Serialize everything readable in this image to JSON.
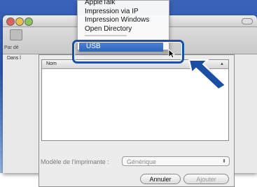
{
  "window": {
    "toolbar_label": "Par dé",
    "sidebar_label": "Dans l"
  },
  "menu": {
    "items": [
      "AppleTalk",
      "Impression via IP",
      "Impression Windows",
      "Open Directory"
    ],
    "selected": "USB"
  },
  "list": {
    "column": "Nom"
  },
  "model": {
    "label": "Modèle de l'imprimante :",
    "value": "Générique"
  },
  "buttons": {
    "cancel": "Annuler",
    "add": "Ajouter"
  },
  "colors": {
    "selection": "#2f63c2",
    "callout": "#1a4fa6"
  }
}
